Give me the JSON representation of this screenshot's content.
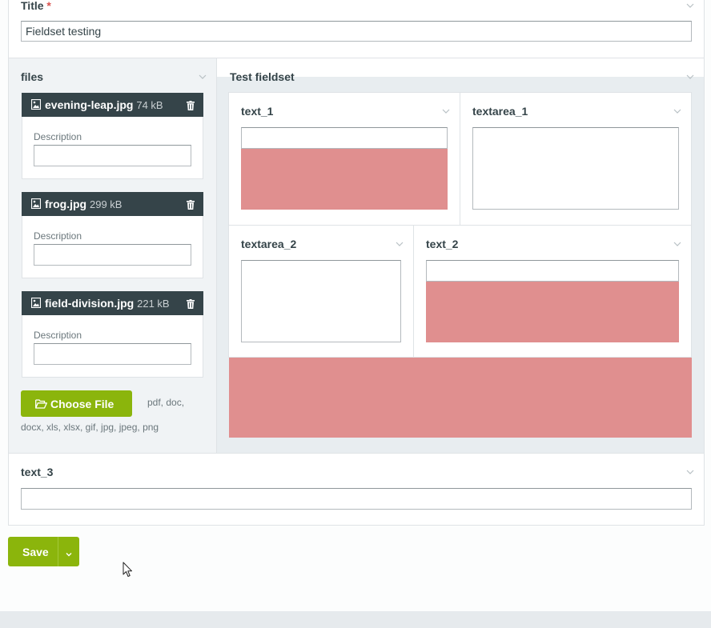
{
  "title_field": {
    "label": "Title",
    "required_mark": "*",
    "value": "Fieldset testing"
  },
  "files": {
    "label": "files",
    "items": [
      {
        "name": "evening-leap.jpg",
        "size": "74 kB",
        "description_label": "Description",
        "description_value": ""
      },
      {
        "name": "frog.jpg",
        "size": "299 kB",
        "description_label": "Description",
        "description_value": ""
      },
      {
        "name": "field-division.jpg",
        "size": "221 kB",
        "description_label": "Description",
        "description_value": ""
      }
    ],
    "choose_button": "Choose File",
    "allowed_types_line1": "pdf, doc,",
    "allowed_types_line2": "docx, xls, xlsx, gif, jpg, jpeg, png"
  },
  "fieldset": {
    "label": "Test fieldset",
    "text_1": {
      "label": "text_1",
      "value": ""
    },
    "textarea_1": {
      "label": "textarea_1",
      "value": ""
    },
    "textarea_2": {
      "label": "textarea_2",
      "value": ""
    },
    "text_2": {
      "label": "text_2",
      "value": ""
    }
  },
  "text_3": {
    "label": "text_3",
    "value": ""
  },
  "actions": {
    "save": "Save"
  },
  "colors": {
    "accent": "#8bb50c",
    "dark_header": "#354449",
    "error_highlight": "#e08f8f",
    "required": "#d9534f"
  },
  "icons": [
    "chevron-down-icon",
    "image-file-icon",
    "trash-icon",
    "folder-open-icon",
    "mouse-cursor-icon"
  ]
}
